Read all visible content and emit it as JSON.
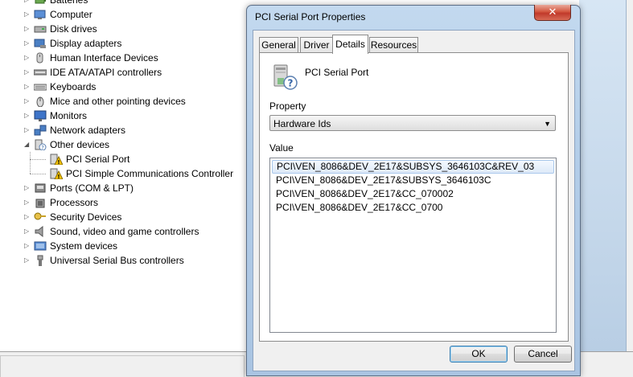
{
  "tree": {
    "items": [
      {
        "label": "Batteries",
        "expander": "▷",
        "icon": "battery-icon"
      },
      {
        "label": "Computer",
        "expander": "▷",
        "icon": "computer-icon"
      },
      {
        "label": "Disk drives",
        "expander": "▷",
        "icon": "disk-drive-icon"
      },
      {
        "label": "Display adapters",
        "expander": "▷",
        "icon": "display-adapter-icon"
      },
      {
        "label": "Human Interface Devices",
        "expander": "▷",
        "icon": "hid-icon"
      },
      {
        "label": "IDE ATA/ATAPI controllers",
        "expander": "▷",
        "icon": "ide-controller-icon"
      },
      {
        "label": "Keyboards",
        "expander": "▷",
        "icon": "keyboard-icon"
      },
      {
        "label": "Mice and other pointing devices",
        "expander": "▷",
        "icon": "mouse-icon"
      },
      {
        "label": "Monitors",
        "expander": "▷",
        "icon": "monitor-icon"
      },
      {
        "label": "Network adapters",
        "expander": "▷",
        "icon": "network-adapter-icon"
      },
      {
        "label": "Other devices",
        "expander": "◢",
        "icon": "other-devices-icon"
      },
      {
        "label": "PCI Serial Port",
        "child": true,
        "icon": "warning-device-icon"
      },
      {
        "label": "PCI Simple Communications Controller",
        "child": true,
        "icon": "warning-device-icon"
      },
      {
        "label": "Ports (COM & LPT)",
        "expander": "▷",
        "icon": "port-icon"
      },
      {
        "label": "Processors",
        "expander": "▷",
        "icon": "processor-icon"
      },
      {
        "label": "Security Devices",
        "expander": "▷",
        "icon": "security-key-icon"
      },
      {
        "label": "Sound, video and game controllers",
        "expander": "▷",
        "icon": "speaker-icon"
      },
      {
        "label": "System devices",
        "expander": "▷",
        "icon": "system-device-icon"
      },
      {
        "label": "Universal Serial Bus controllers",
        "expander": "▷",
        "icon": "usb-icon"
      }
    ]
  },
  "dialog": {
    "title": "PCI Serial Port Properties",
    "close_glyph": "✕",
    "tabs": [
      {
        "label": "General",
        "active": false
      },
      {
        "label": "Driver",
        "active": false
      },
      {
        "label": "Details",
        "active": true
      },
      {
        "label": "Resources",
        "active": false
      }
    ],
    "device_name": "PCI Serial Port",
    "property_label": "Property",
    "property_value": "Hardware Ids",
    "value_label": "Value",
    "values": [
      "PCI\\VEN_8086&DEV_2E17&SUBSYS_3646103C&REV_03",
      "PCI\\VEN_8086&DEV_2E17&SUBSYS_3646103C",
      "PCI\\VEN_8086&DEV_2E17&CC_070002",
      "PCI\\VEN_8086&DEV_2E17&CC_0700"
    ],
    "selected_value_index": 0,
    "ok_label": "OK",
    "cancel_label": "Cancel"
  },
  "colors": {
    "selection": "#dde9f8",
    "warning": "#f5c400",
    "close_button": "#c0392b"
  }
}
